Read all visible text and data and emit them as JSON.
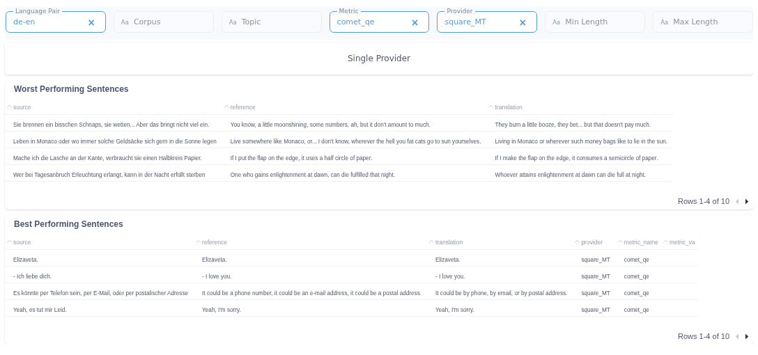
{
  "filters": [
    {
      "kind": "select",
      "label": "Language Pair",
      "value": "de-en",
      "clear": "×"
    },
    {
      "kind": "text",
      "prefix": "Aa",
      "placeholder": "Corpus"
    },
    {
      "kind": "text",
      "prefix": "Aa",
      "placeholder": "Topic"
    },
    {
      "kind": "select",
      "label": "Metric",
      "value": "comet_qe",
      "clear": "×"
    },
    {
      "kind": "select",
      "label": "Provider",
      "value": "square_MT",
      "clear": "×"
    },
    {
      "kind": "text",
      "prefix": "Aa",
      "placeholder": "Min Length"
    },
    {
      "kind": "text",
      "prefix": "Aa",
      "placeholder": "Max Length"
    }
  ],
  "heading": "Single Provider",
  "tables": [
    {
      "title": "Worst Performing Sentences",
      "columns": [
        "source",
        "reference",
        "translation"
      ],
      "rows": [
        [
          "Sie brennen ein bisschen Schnaps, sie wetten... Aber das bringt nicht viel ein.",
          "You know, a little moonshining, some numbers, ah, but it don't amount to much.",
          "They burn a little booze, they bet... but that doesn't pay much."
        ],
        [
          "Leben in Monaco oder wo immer solche Geldsäcke sich gern in die Sonne legen",
          "Live somewhere like Monaco, or... I don't know, wherever the hell you fat cats go to sun yourselves.",
          "Living in Monaco or wherever such money bags like to lie in the sun."
        ],
        [
          "Mache ich die Lasche an der Kante, verbraucht sie einen Halbkreis Papier.",
          "If I put the flap on the edge, it uses a half circle of paper.",
          "If I make the flap on the edge, it consumes a semicircle of paper."
        ],
        [
          "Wer bei Tagesanbruch Erleuchtung erlangt, kann in der Nacht erfüllt sterben",
          "One who gains enlightenment at dawn, can die fulfilled that night.",
          "Whoever attains enlightenment at dawn can die full at night."
        ]
      ],
      "pagination": {
        "label": "Rows 1-4 of 10",
        "prev_disabled": true,
        "next_disabled": false
      }
    },
    {
      "title": "Best Performing Sentences",
      "columns": [
        "source",
        "reference",
        "translation",
        "provider",
        "metric_name",
        "metric_va"
      ],
      "rows": [
        [
          "Elizaveta.",
          "Elizaveta.",
          "Elizaveta.",
          "square_MT",
          "comet_qe"
        ],
        [
          "- Ich liebe dich.",
          "- I love you.",
          "- I love you.",
          "square_MT",
          "comet_qe"
        ],
        [
          "Es könnte per Telefon sein, per E-Mail, oder per postalischer Adresse",
          "It could be a phone number, it could be an e-mail address, it could be a postal address.",
          "It could be by phone, by email, or by postal address.",
          "square_MT",
          "comet_qe"
        ],
        [
          "Yeah, es tut mir Leid.",
          "Yeah, I'm sorry.",
          "Yeah, I'm sorry.",
          "square_MT",
          "comet_qe"
        ]
      ],
      "pagination": {
        "label": "Rows 1-4 of 10",
        "prev_disabled": true,
        "next_disabled": false
      }
    }
  ]
}
